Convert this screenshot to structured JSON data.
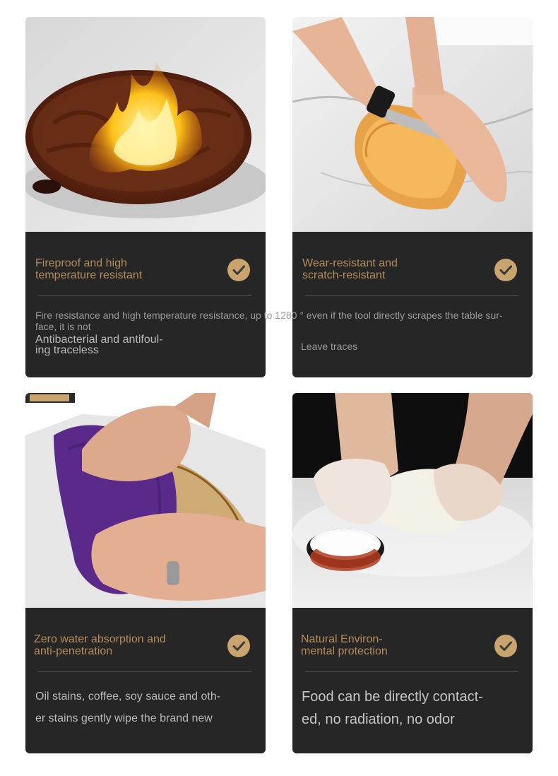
{
  "cards": [
    {
      "title": "Fireproof and high\ntemperature resistant",
      "photo": "flaming-steak-on-countertop",
      "description": "Fire resistance and high temperature resistance, up to 1280 ° even if the tool directly scrapes the table sur-\nface, it is not",
      "subtitle": "Antibacterial and antifoul-\ning traceless"
    },
    {
      "title": "Wear-resistant and\nscratch-resistant",
      "photo": "knife-cutting-melon",
      "description": "Leave traces"
    },
    {
      "title": "Zero water absorption and\nanti-penetration",
      "photo": "hands-wiping-stain-with-cloth",
      "description": "Oil stains, coffee, soy sauce and oth-\ner stains gently wipe the brand new"
    },
    {
      "title": "Natural Environ-\nmental protection",
      "photo": "hands-kneading-dough",
      "description": "Food can be directly contact-\ned, no radiation, no odor"
    }
  ],
  "icons": {
    "check": "check-circle-icon"
  },
  "colors": {
    "panel": "#262626",
    "title_gold": "#b48c5a",
    "check_badge": "#c9a46e"
  }
}
